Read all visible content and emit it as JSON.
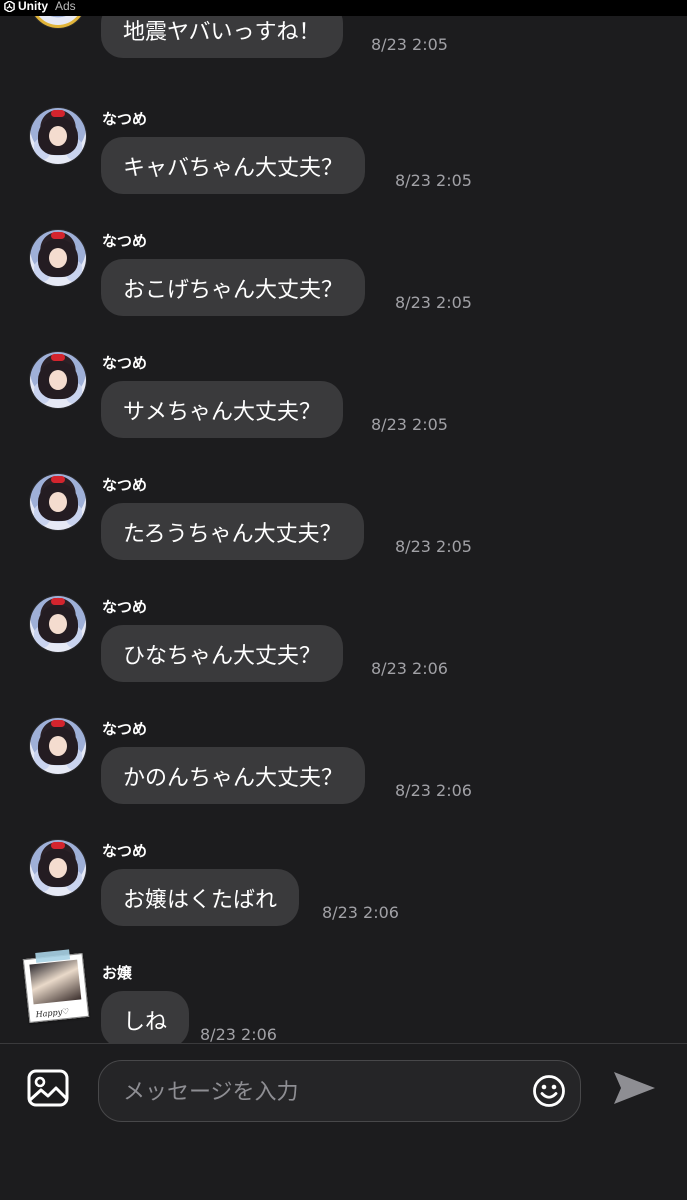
{
  "ad": {
    "brand": "Unity",
    "label": "Ads",
    "icon": "unity-logo-icon"
  },
  "messages": [
    {
      "sender": "",
      "text": "地震ヤバいっすね！",
      "time": "8/23 2:05",
      "avatar": "avatar-round"
    },
    {
      "sender": "なつめ",
      "text": "キャバちゃん大丈夫？",
      "time": "8/23 2:05",
      "avatar": "avatar-round"
    },
    {
      "sender": "なつめ",
      "text": "おこげちゃん大丈夫？",
      "time": "8/23 2:05",
      "avatar": "avatar-round"
    },
    {
      "sender": "なつめ",
      "text": "サメちゃん大丈夫？",
      "time": "8/23 2:05",
      "avatar": "avatar-round"
    },
    {
      "sender": "なつめ",
      "text": "たろうちゃん大丈夫？",
      "time": "8/23 2:05",
      "avatar": "avatar-round"
    },
    {
      "sender": "なつめ",
      "text": "ひなちゃん大丈夫？",
      "time": "8/23 2:06",
      "avatar": "avatar-round"
    },
    {
      "sender": "なつめ",
      "text": "かのんちゃん大丈夫？",
      "time": "8/23 2:06",
      "avatar": "avatar-round"
    },
    {
      "sender": "なつめ",
      "text": "お嬢はくたばれ",
      "time": "8/23 2:06",
      "avatar": "avatar-round"
    },
    {
      "sender": "お嬢",
      "text": "しね",
      "time": "8/23 2:06",
      "avatar": "avatar-polaroid",
      "avatar_caption": "Happy♡"
    }
  ],
  "composer": {
    "placeholder": "メッセージを入力",
    "value": "",
    "image_icon": "image-icon",
    "emoji_icon": "smiley-icon",
    "send_icon": "send-icon"
  },
  "colors": {
    "background": "#1c1c1e",
    "bubble": "#3a3a3c",
    "text": "#ffffff",
    "timestamp": "#a1a1a6",
    "send": "#8e8e93"
  }
}
